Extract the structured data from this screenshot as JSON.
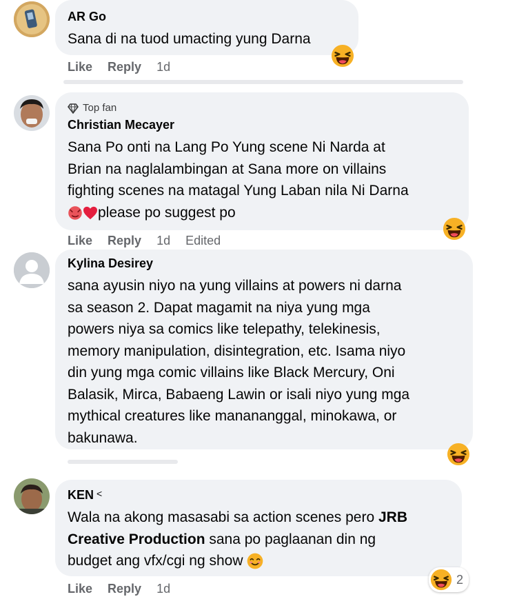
{
  "comments": [
    {
      "author": "AR Go",
      "text": "Sana di na tuod umacting yung Darna",
      "actions": {
        "like": "Like",
        "reply": "Reply",
        "time": "1d"
      }
    },
    {
      "badge": "Top fan",
      "author": "Christian Mecayer",
      "text_lines": [
        "Sana Po onti na Lang Po Yung scene Ni Narda at",
        "Brian na naglalambingan at Sana more on villains",
        "fighting scenes na matagal Yung Laban nila Ni Darna"
      ],
      "last_line": "please po suggest po",
      "actions": {
        "like": "Like",
        "reply": "Reply",
        "time": "1d",
        "edited": "Edited"
      }
    },
    {
      "author": "Kylina Desirey",
      "text_lines": [
        "sana ayusin niyo na yung villains at powers ni darna",
        "sa season 2. Dapat magamit na niya yung mga",
        "powers niya sa comics like telepathy, telekinesis,",
        "memory manipulation, disintegration, etc. Isama niyo",
        "din yung mga comic villains like Black Mercury, Oni",
        "Balasik, Mirca, Babaeng Lawin or isali niyo yung mga",
        "mythical creatures like manananggal, minokawa, or",
        "bakunawa."
      ]
    },
    {
      "author": "KEN",
      "text_part1": "Wala na akong masasabi sa action scenes pero ",
      "text_bold1": "JRB",
      "text_bold2": "Creative Production",
      "text_part2": " sana po paglaanan din ng",
      "text_part3": "budget ang vfx/cgi ng show ",
      "reaction_count": "2",
      "actions": {
        "like": "Like",
        "reply": "Reply",
        "time": "1d"
      }
    }
  ],
  "colors": {
    "bubble": "#f0f2f5",
    "meta_text": "#65676b",
    "emoji_face": "#f7b125",
    "heart": "#e41e3f"
  }
}
